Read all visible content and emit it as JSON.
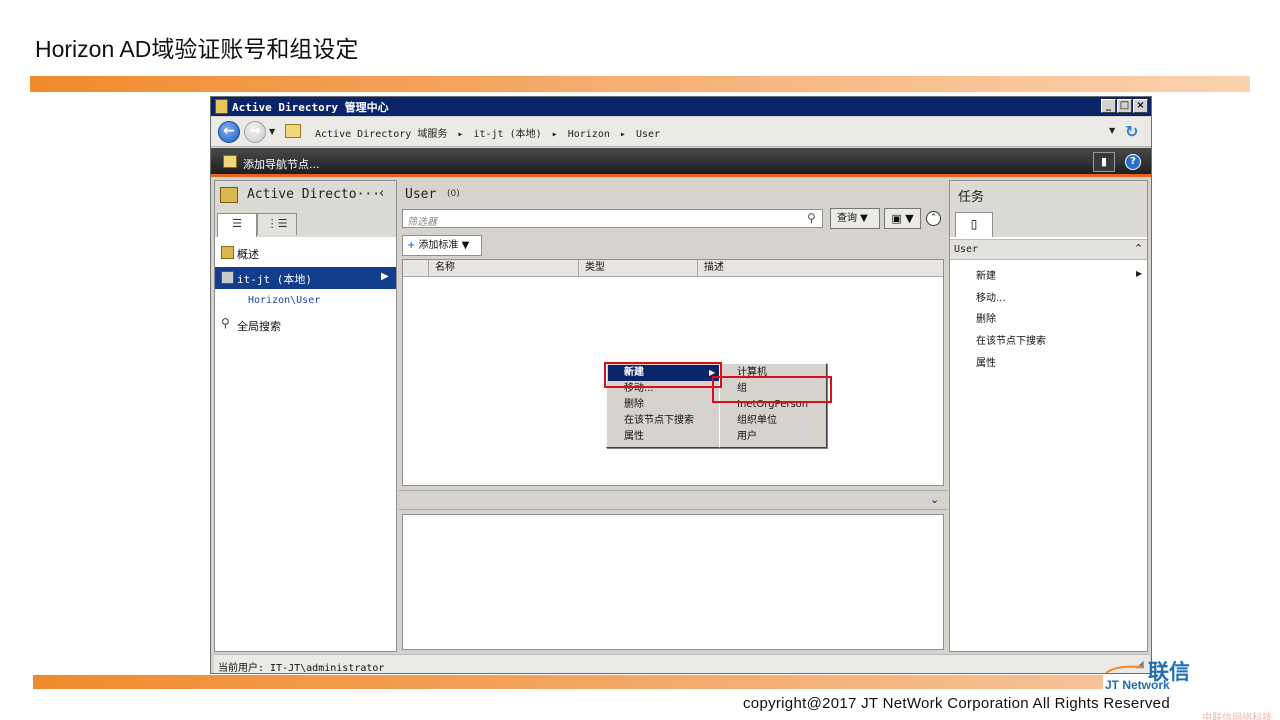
{
  "slide": {
    "title": "Horizon AD域验证账号和组设定",
    "copyright": "copyright@2017  JT NetWork Corporation All Rights Reserved",
    "logo_cn": "联信",
    "logo_en": "JT Network",
    "watermark": "中联信网络科技"
  },
  "window": {
    "title": "Active Directory 管理中心",
    "buttons": {
      "minimize": "_",
      "maximize": "□",
      "close": "×"
    }
  },
  "address_bar": {
    "path": [
      "Active Directory 域服务",
      "it-jt (本地)",
      "Horizon",
      "User"
    ],
    "separator": "▸"
  },
  "nav_bar": {
    "add_node_label": "添加导航节点..."
  },
  "left_pane": {
    "header": "Active Directo···",
    "tabs": [
      "☰",
      "⋮☰"
    ],
    "items": [
      {
        "label": "概述"
      },
      {
        "label": "it-jt (本地)",
        "selected": true
      },
      {
        "label": "全局搜索"
      }
    ],
    "sub_item": "Horizon\\User"
  },
  "center": {
    "title": "User",
    "count": "(0)",
    "filter_placeholder": "筛选器",
    "query_label": "查询",
    "add_criteria_label": "添加标准",
    "columns": [
      "名称",
      "类型",
      "描述"
    ]
  },
  "context_menu": {
    "items": [
      "新建",
      "移动...",
      "删除",
      "在该节点下搜索",
      "属性"
    ],
    "submenu": [
      "计算机",
      "组",
      "InetOrgPerson",
      "组织单位",
      "用户"
    ]
  },
  "tasks": {
    "title": "任务",
    "group": "User",
    "items": [
      "新建",
      "移动...",
      "删除",
      "在该节点下搜索",
      "属性"
    ]
  },
  "status": {
    "current_user": "当前用户: IT-JT\\administrator"
  },
  "colors": {
    "accent_orange": "#f08a2c",
    "titlebar_blue": "#0a246a",
    "highlight_red": "#d9101a",
    "logo_blue": "#1f6fb2"
  }
}
